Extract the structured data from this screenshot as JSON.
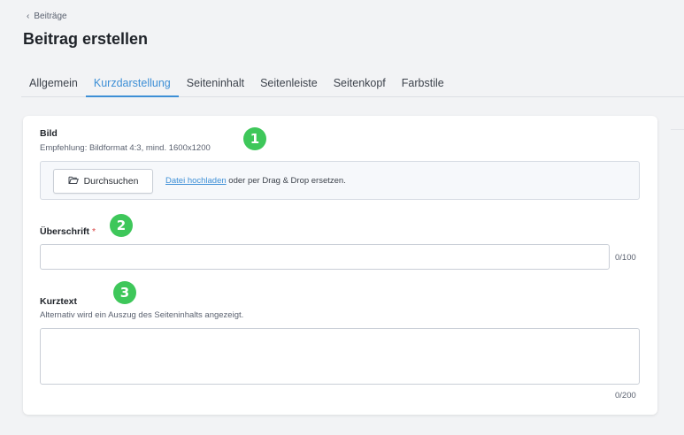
{
  "breadcrumb": {
    "back_label": "Beiträge"
  },
  "page": {
    "title": "Beitrag erstellen"
  },
  "tabs": [
    {
      "label": "Allgemein",
      "active": false
    },
    {
      "label": "Kurzdarstellung",
      "active": true
    },
    {
      "label": "Seiteninhalt",
      "active": false
    },
    {
      "label": "Seitenleiste",
      "active": false
    },
    {
      "label": "Seitenkopf",
      "active": false
    },
    {
      "label": "Farbstile",
      "active": false
    }
  ],
  "image_field": {
    "label": "Bild",
    "hint": "Empfehlung: Bildformat 4:3, mind. 1600x1200",
    "browse_label": "Durchsuchen",
    "upload_link": "Datei hochladen",
    "upload_suffix": " oder per Drag & Drop ersetzen.",
    "icon": "folder-open-icon"
  },
  "heading_field": {
    "label": "Überschrift",
    "required_mark": "*",
    "value": "",
    "counter": "0/100"
  },
  "short_text_field": {
    "label": "Kurztext",
    "hint": "Alternativ wird ein Auszug des Seiteninhalts angezeigt.",
    "value": "",
    "counter": "0/200"
  },
  "annotations": [
    "1",
    "2",
    "3"
  ],
  "colors": {
    "accent": "#3d8fd6",
    "badge": "#3ec75a",
    "required": "#d94444",
    "background": "#f2f3f5"
  }
}
